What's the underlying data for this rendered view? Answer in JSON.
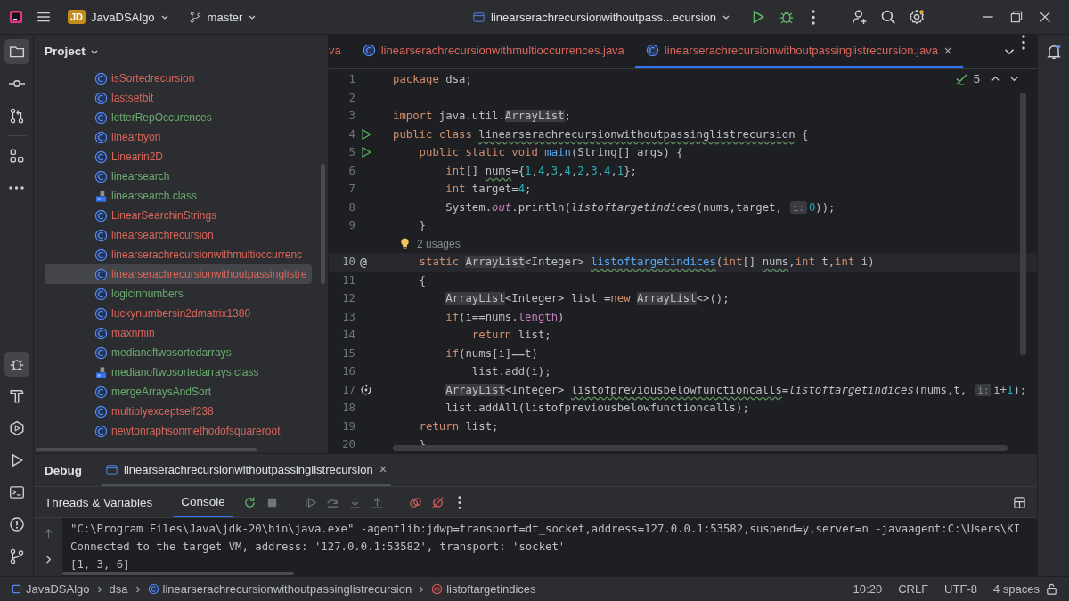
{
  "title_bar": {
    "project_badge": "JD",
    "project_name": "JavaDSAlgo",
    "branch": "master",
    "run_config": "linearserachrecursionwithoutpass...ecursion"
  },
  "tool_strip_top": [
    {
      "kind": "project",
      "selected": true
    },
    {
      "kind": "commit",
      "selected": false
    },
    {
      "kind": "pull-requests",
      "selected": false
    },
    {
      "kind": "structure",
      "selected": false
    },
    {
      "kind": "more",
      "selected": false
    }
  ],
  "tool_strip_bottom": [
    {
      "kind": "debug",
      "selected": true
    },
    {
      "kind": "build",
      "selected": false
    },
    {
      "kind": "services",
      "selected": false
    },
    {
      "kind": "run",
      "selected": false
    },
    {
      "kind": "terminal",
      "selected": false
    },
    {
      "kind": "problems",
      "selected": false
    },
    {
      "kind": "git",
      "selected": false
    }
  ],
  "project_panel": {
    "title": "Project",
    "items": [
      {
        "name": "isSortedrecursion",
        "kind": "class",
        "color": "#d9655b",
        "selected": false
      },
      {
        "name": "lastsetbit",
        "kind": "class",
        "color": "#d9655b",
        "selected": false
      },
      {
        "name": "letterRepOccurences",
        "kind": "class",
        "color": "#6cab70",
        "selected": false
      },
      {
        "name": "linearbyon",
        "kind": "class",
        "color": "#d9655b",
        "selected": false
      },
      {
        "name": "Linearin2D",
        "kind": "class",
        "color": "#d9655b",
        "selected": false
      },
      {
        "name": "linearsearch",
        "kind": "class",
        "color": "#6cab70",
        "selected": false
      },
      {
        "name": "linearsearch.class",
        "kind": "classfile",
        "color": "#6cab70",
        "selected": false
      },
      {
        "name": "LinearSearchinStrings",
        "kind": "class",
        "color": "#d9655b",
        "selected": false
      },
      {
        "name": "linearsearchrecursion",
        "kind": "class",
        "color": "#d9655b",
        "selected": false
      },
      {
        "name": "linearserachrecursionwithmultioccurrenc",
        "kind": "class",
        "color": "#d9655b",
        "selected": false
      },
      {
        "name": "linearserachrecursionwithoutpassinglistre",
        "kind": "class",
        "color": "#d9655b",
        "selected": true
      },
      {
        "name": "logicinnumbers",
        "kind": "class",
        "color": "#6cab70",
        "selected": false
      },
      {
        "name": "luckynumbersin2dmatrix1380",
        "kind": "class",
        "color": "#d9655b",
        "selected": false
      },
      {
        "name": "maxnmin",
        "kind": "class",
        "color": "#d9655b",
        "selected": false
      },
      {
        "name": "medianoftwosortedarrays",
        "kind": "class",
        "color": "#6cab70",
        "selected": false
      },
      {
        "name": "medianoftwosortedarrays.class",
        "kind": "classfile",
        "color": "#6cab70",
        "selected": false
      },
      {
        "name": "mergeArraysAndSort",
        "kind": "class",
        "color": "#6cab70",
        "selected": false
      },
      {
        "name": "multiplyexceptself238",
        "kind": "class",
        "color": "#d9655b",
        "selected": false
      },
      {
        "name": "newtonraphsonmethodofsquareroot",
        "kind": "class",
        "color": "#d9655b",
        "selected": false
      }
    ]
  },
  "editor_tabs": [
    {
      "label": "va",
      "selected": false,
      "closable": false,
      "icon": false
    },
    {
      "label": "linearserachrecursionwithmultioccurrences.java",
      "selected": false,
      "closable": false,
      "icon": true
    },
    {
      "label": "linearserachrecursionwithoutpassinglistrecursion.java",
      "selected": true,
      "closable": true,
      "icon": true
    }
  ],
  "inspections": {
    "count": "5"
  },
  "code_lines": [
    {
      "number": "1",
      "kind": "code",
      "tokens": [
        {
          "kind": "kw",
          "text": "package"
        },
        {
          "kind": "plain",
          "text": " dsa;"
        }
      ]
    },
    {
      "number": "2",
      "kind": "code"
    },
    {
      "number": "3",
      "kind": "code",
      "tokens": [
        {
          "kind": "kw",
          "text": "import"
        },
        {
          "kind": "plain",
          "text": " java.util."
        },
        {
          "kind": "hl",
          "text": "ArrayList"
        },
        {
          "kind": "plain",
          "text": ";"
        }
      ]
    },
    {
      "number": "4",
      "kind": "code",
      "gutter": {
        "kind": "run"
      },
      "tokens": [
        {
          "kind": "kw",
          "text": "public class "
        },
        {
          "kind": "warn",
          "text": "linearserachrecursionwithoutpassinglistrecursion"
        },
        {
          "kind": "plain",
          "text": " {"
        }
      ]
    },
    {
      "number": "5",
      "kind": "code",
      "gutter": {
        "kind": "run"
      },
      "tokens": [
        {
          "kind": "kw",
          "text": "    public static void "
        },
        {
          "kind": "fn",
          "text": "main"
        },
        {
          "kind": "plain",
          "text": "(String[] args) {"
        }
      ]
    },
    {
      "number": "6",
      "kind": "code",
      "tokens": [
        {
          "kind": "kw",
          "text": "        int"
        },
        {
          "kind": "plain",
          "text": "[] "
        },
        {
          "kind": "warn",
          "text": "nums"
        },
        {
          "kind": "plain",
          "text": "={"
        },
        {
          "kind": "num",
          "text": "1"
        },
        {
          "kind": "plain",
          "text": ","
        },
        {
          "kind": "num",
          "text": "4"
        },
        {
          "kind": "plain",
          "text": ","
        },
        {
          "kind": "num",
          "text": "3"
        },
        {
          "kind": "plain",
          "text": ","
        },
        {
          "kind": "num",
          "text": "4"
        },
        {
          "kind": "plain",
          "text": ","
        },
        {
          "kind": "num",
          "text": "2"
        },
        {
          "kind": "plain",
          "text": ","
        },
        {
          "kind": "num",
          "text": "3"
        },
        {
          "kind": "plain",
          "text": ","
        },
        {
          "kind": "num",
          "text": "4"
        },
        {
          "kind": "plain",
          "text": ","
        },
        {
          "kind": "num",
          "text": "1"
        },
        {
          "kind": "plain",
          "text": "};"
        }
      ]
    },
    {
      "number": "7",
      "kind": "code",
      "tokens": [
        {
          "kind": "kw",
          "text": "        int"
        },
        {
          "kind": "plain",
          "text": " target="
        },
        {
          "kind": "num",
          "text": "4"
        },
        {
          "kind": "plain",
          "text": ";"
        }
      ]
    },
    {
      "number": "8",
      "kind": "code",
      "tokens": [
        {
          "kind": "plain",
          "text": "        System."
        },
        {
          "kind": "field",
          "text": "out"
        },
        {
          "kind": "plain",
          "text": ".println("
        },
        {
          "kind": "call",
          "text": "listoftargetindices"
        },
        {
          "kind": "plain",
          "text": "(nums,target, "
        },
        {
          "kind": "hint",
          "text": "i:"
        },
        {
          "kind": "num",
          "text": "0"
        },
        {
          "kind": "plain",
          "text": "));"
        }
      ]
    },
    {
      "number": "9",
      "kind": "code",
      "tokens": [
        {
          "kind": "plain",
          "text": "    }"
        }
      ]
    },
    {
      "kind": "usages",
      "bulb": true,
      "text": "2 usages"
    },
    {
      "number": "10",
      "kind": "code",
      "current": true,
      "gutter": {
        "kind": "text",
        "text": "@"
      },
      "tokens": [
        {
          "kind": "kw",
          "text": "    static "
        },
        {
          "kind": "hl",
          "text": "ArrayList"
        },
        {
          "kind": "plain",
          "text": "<Integer> "
        },
        {
          "kind": "fnwarn",
          "text": "listoftargetindices"
        },
        {
          "kind": "plain",
          "text": "("
        },
        {
          "kind": "kw",
          "text": "int"
        },
        {
          "kind": "plain",
          "text": "[] "
        },
        {
          "kind": "warn",
          "text": "nums"
        },
        {
          "kind": "plain",
          "text": ","
        },
        {
          "kind": "kw",
          "text": "int"
        },
        {
          "kind": "plain",
          "text": " t,"
        },
        {
          "kind": "kw",
          "text": "int"
        },
        {
          "kind": "plain",
          "text": " i)"
        }
      ]
    },
    {
      "number": "11",
      "kind": "code",
      "current": false,
      "tokens": [
        {
          "kind": "plain",
          "text": "    {"
        }
      ]
    },
    {
      "number": "12",
      "kind": "code",
      "tokens": [
        {
          "kind": "hl",
          "text": "        ArrayList"
        },
        {
          "kind": "plain",
          "text": "<Integer> list ="
        },
        {
          "kind": "kw",
          "text": "new "
        },
        {
          "kind": "hl",
          "text": "ArrayList"
        },
        {
          "kind": "plain",
          "text": "<>();"
        }
      ]
    },
    {
      "number": "13",
      "kind": "code",
      "tokens": [
        {
          "kind": "kw",
          "text": "        if"
        },
        {
          "kind": "plain",
          "text": "(i==nums."
        },
        {
          "kind": "prop",
          "text": "length"
        },
        {
          "kind": "plain",
          "text": ")"
        }
      ]
    },
    {
      "number": "14",
      "kind": "code",
      "tokens": [
        {
          "kind": "kw",
          "text": "            return"
        },
        {
          "kind": "plain",
          "text": " list;"
        }
      ]
    },
    {
      "number": "15",
      "kind": "code",
      "tokens": [
        {
          "kind": "kw",
          "text": "        if"
        },
        {
          "kind": "plain",
          "text": "(nums[i]==t)"
        }
      ]
    },
    {
      "number": "16",
      "kind": "code",
      "tokens": [
        {
          "kind": "plain",
          "text": "            list.add(i);"
        }
      ]
    },
    {
      "number": "17",
      "kind": "code",
      "gutter": {
        "kind": "recursion"
      },
      "tokens": [
        {
          "kind": "hl",
          "text": "        ArrayList"
        },
        {
          "kind": "plain",
          "text": "<Integer> "
        },
        {
          "kind": "warn",
          "text": "listofpreviousbelowfunctioncalls"
        },
        {
          "kind": "plain",
          "text": "="
        },
        {
          "kind": "call",
          "text": "listoftargetindices"
        },
        {
          "kind": "plain",
          "text": "(nums,t, "
        },
        {
          "kind": "hint",
          "text": "i:"
        },
        {
          "kind": "plain",
          "text": "i+"
        },
        {
          "kind": "num",
          "text": "1"
        },
        {
          "kind": "plain",
          "text": ");"
        }
      ]
    },
    {
      "number": "18",
      "kind": "code",
      "tokens": [
        {
          "kind": "plain",
          "text": "        list.addAll(listofpreviousbelowfunctioncalls);"
        }
      ]
    },
    {
      "number": "19",
      "kind": "code",
      "tokens": [
        {
          "kind": "kw",
          "text": "    return"
        },
        {
          "kind": "plain",
          "text": " list;"
        }
      ]
    },
    {
      "number": "20",
      "kind": "code",
      "tokens": [
        {
          "kind": "plain",
          "text": "    }"
        }
      ]
    }
  ],
  "debug_panel": {
    "title": "Debug",
    "session_tab": "linearserachrecursionwithoutpassinglistrecursion",
    "tabs": [
      {
        "label": "Threads & Variables",
        "selected": false
      },
      {
        "label": "Console",
        "selected": true
      }
    ],
    "console_lines": [
      "\"C:\\Program Files\\Java\\jdk-20\\bin\\java.exe\" -agentlib:jdwp=transport=dt_socket,address=127.0.0.1:53582,suspend=y,server=n -javaagent:C:\\Users\\KI",
      "Connected to the target VM, address: '127.0.0.1:53582', transport: 'socket'",
      "[1, 3, 6]"
    ]
  },
  "status_bar": {
    "breadcrumbs": [
      {
        "kind": "module",
        "text": "JavaDSAlgo"
      },
      {
        "kind": "package",
        "text": "dsa"
      },
      {
        "kind": "class",
        "text": "linearserachrecursionwithoutpassinglistrecursion"
      },
      {
        "kind": "method",
        "text": "listoftargetindices"
      }
    ],
    "position": "10:20",
    "line_separator": "CRLF",
    "encoding": "UTF-8",
    "indent": "4 spaces"
  }
}
